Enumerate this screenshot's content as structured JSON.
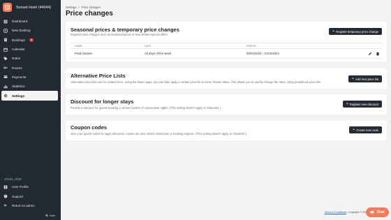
{
  "sidebar": {
    "hotel_name": "Sunset Hotel (44044)",
    "items": [
      {
        "label": "Dashboard",
        "icon": "dashboard-icon"
      },
      {
        "label": "New booking",
        "icon": "plus-icon"
      },
      {
        "label": "Bookings",
        "icon": "book-icon",
        "badge": "2"
      },
      {
        "label": "Calendar",
        "icon": "calendar-icon"
      },
      {
        "label": "Rates",
        "icon": "tag-icon"
      },
      {
        "label": "Rooms",
        "icon": "key-icon"
      },
      {
        "label": "Payments",
        "icon": "wallet-icon"
      },
      {
        "label": "Statistics",
        "icon": "chart-icon"
      },
      {
        "label": "Settings",
        "icon": "gear-icon",
        "active": true
      }
    ],
    "user_heading": "JOHN_DOE",
    "user_items": [
      {
        "label": "User Profile",
        "icon": "user-icon"
      },
      {
        "label": "Support",
        "icon": "help-icon"
      },
      {
        "label": "Return to admin",
        "icon": "arrow-left-icon"
      }
    ],
    "hide_label": "Hide"
  },
  "breadcrumb": {
    "parent": "Settings",
    "separator": "/",
    "current": "Price changes"
  },
  "page_title": "Price changes",
  "seasonal": {
    "title": "Seasonal prices & temporary price changes",
    "desc": "Register price changes such as seasonal prices or time-limited special offers.",
    "button": "Register temporary price change",
    "columns": [
      "NAME",
      "DATE",
      "PERIOD"
    ],
    "rows": [
      {
        "name": "Peak Season",
        "date": "All days of the week",
        "period": "03/04/2024 - 21/04/2024"
      }
    ]
  },
  "alt_lists": {
    "title": "Alternative Price Lists",
    "desc": "Alternative price lists can be created here. Using the Rates page, you can later apply a certain price list to some chosen dates. This allows you to quickly change the rates, using predefined price lists.",
    "button": "Add new price list"
  },
  "longer_stays": {
    "title": "Discount for longer stays",
    "desc": "Provide a discount for guests booking a certain number of consecutive nights. (This setting doesn't apply to Channels.)",
    "button": "Register new discount"
  },
  "coupons": {
    "title": "Coupon codes",
    "desc": "Give your guests codes to apply discounts. Codes can also unlock restrictions or booking engines. (This setting doesn't apply to Channels.)",
    "button": "Create new code"
  },
  "footer": {
    "link": "Terms & Conditions",
    "sep": "|",
    "copyright": "Copyright © 2024"
  },
  "chat": {
    "label": "Chat"
  },
  "colors": {
    "accent": "#f27c5c",
    "sidebar": "#232932",
    "button": "#252b33",
    "badge": "#e23a3a"
  }
}
